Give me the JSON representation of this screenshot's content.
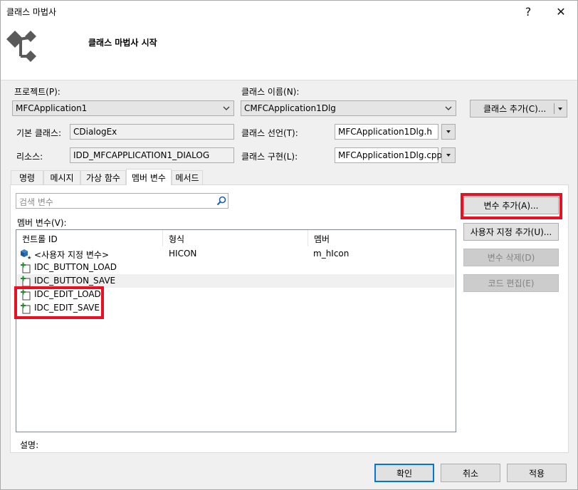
{
  "window": {
    "title": "클래스 마법사",
    "help_glyph": "?",
    "close_glyph": "✕"
  },
  "header": {
    "title": "클래스 마법사 시작"
  },
  "project": {
    "label": "프로젝트(P):",
    "value": "MFCApplication1"
  },
  "class_name": {
    "label": "클래스 이름(N):",
    "value": "CMFCApplication1Dlg"
  },
  "add_class_button": {
    "label": "클래스 추가(C)..."
  },
  "base_class": {
    "label": "기본 클래스:",
    "value": "CDialogEx"
  },
  "class_decl": {
    "label": "클래스 선언(T):",
    "value": "MFCApplication1Dlg.h"
  },
  "resource": {
    "label": "리소스:",
    "value": "IDD_MFCAPPLICATION1_DIALOG"
  },
  "class_impl": {
    "label": "클래스 구현(L):",
    "value": "MFCApplication1Dlg.cpp"
  },
  "tabs": [
    {
      "label": "명령"
    },
    {
      "label": "메시지"
    },
    {
      "label": "가상 함수"
    },
    {
      "label": "멤버 변수"
    },
    {
      "label": "메서드"
    }
  ],
  "search": {
    "placeholder": "검색 변수"
  },
  "member_vars": {
    "label": "멤버 변수(V):",
    "columns": [
      "컨트롤 ID",
      "형식",
      "멤버"
    ],
    "rows": [
      {
        "id": "<사용자 지정 변수>",
        "type": "HICON",
        "member": "m_hIcon",
        "icon": "custom-variable-icon"
      },
      {
        "id": "IDC_BUTTON_LOAD",
        "type": "",
        "member": "",
        "icon": "control-add-icon"
      },
      {
        "id": "IDC_BUTTON_SAVE",
        "type": "",
        "member": "",
        "icon": "control-add-icon"
      },
      {
        "id": "IDC_EDIT_LOAD",
        "type": "",
        "member": "",
        "icon": "control-add-icon"
      },
      {
        "id": "IDC_EDIT_SAVE",
        "type": "",
        "member": "",
        "icon": "control-add-icon"
      }
    ]
  },
  "side_buttons": {
    "add_variable": "변수 추가(A)...",
    "add_custom": "사용자 지정 추가(U)...",
    "delete_variable": "변수 삭제(D)",
    "edit_code": "코드 편집(E)"
  },
  "description": {
    "label": "설명:"
  },
  "footer": {
    "ok": "확인",
    "cancel": "취소",
    "apply": "적용"
  },
  "colors": {
    "highlight": "#e81123",
    "accent": "#0078d7"
  }
}
